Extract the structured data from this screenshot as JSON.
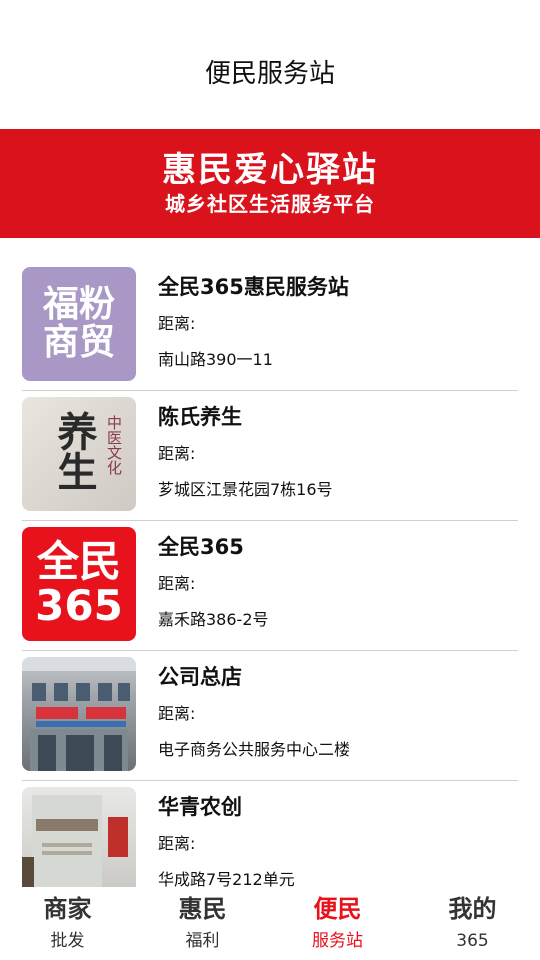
{
  "header": {
    "title": "便民服务站"
  },
  "banner": {
    "title": "惠民爱心驿站",
    "subtitle": "城乡社区生活服务平台"
  },
  "stations": [
    {
      "name": "全民365惠民服务站",
      "distance_label": "距离:",
      "address": "南山路390一11",
      "thumb_text": [
        "福粉",
        "商贸"
      ]
    },
    {
      "name": "陈氏养生",
      "distance_label": "距离:",
      "address": "芗城区江景花园7栋16号",
      "thumb_text": [
        "中医文化",
        "养生"
      ]
    },
    {
      "name": "全民365",
      "distance_label": "距离:",
      "address": "嘉禾路386-2号",
      "thumb_text": [
        "全民",
        "365"
      ]
    },
    {
      "name": "公司总店",
      "distance_label": "距离:",
      "address": "电子商务公共服务中心二楼",
      "thumb_text": []
    },
    {
      "name": "华青农创",
      "distance_label": "距离:",
      "address": "华成路7号212单元",
      "thumb_text": []
    }
  ],
  "tabbar": [
    {
      "big": "商家",
      "small": "批发",
      "active": false
    },
    {
      "big": "惠民",
      "small": "福利",
      "active": false
    },
    {
      "big": "便民",
      "small": "服务站",
      "active": true
    },
    {
      "big": "我的",
      "small": "365",
      "active": false
    }
  ],
  "colors": {
    "accent": "#e8121c",
    "banner": "#d9121c"
  }
}
